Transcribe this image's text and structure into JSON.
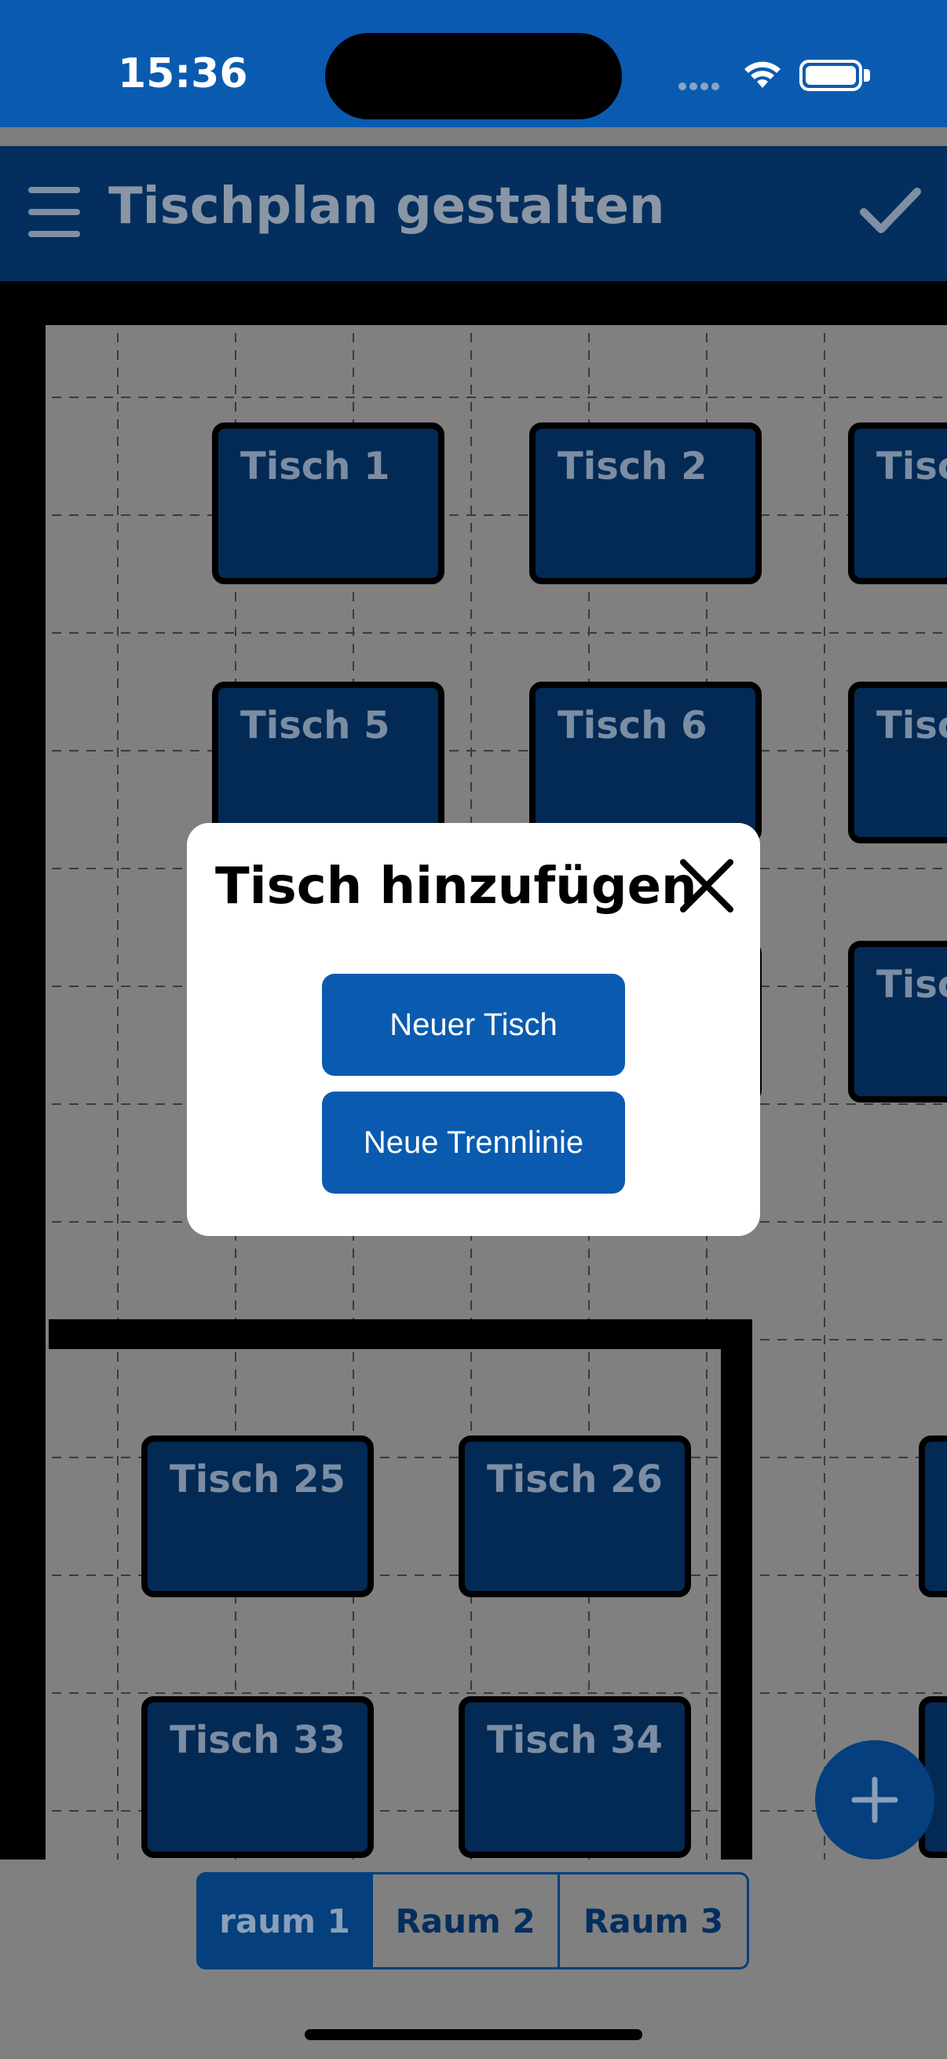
{
  "status": {
    "time": "15:36"
  },
  "appbar": {
    "title": "Tischplan gestalten",
    "menu_icon": "hamburger-menu-icon",
    "confirm_icon": "checkmark-icon"
  },
  "tables": [
    {
      "label": "Tisch 1"
    },
    {
      "label": "Tisch 2"
    },
    {
      "label": "Tisc"
    },
    {
      "label": "Tisch 5"
    },
    {
      "label": "Tisch 6"
    },
    {
      "label": "Tisc"
    },
    {
      "label": "Tisc"
    },
    {
      "label": "Tisch 25"
    },
    {
      "label": "Tisch 26"
    },
    {
      "label": "Tisch 33"
    },
    {
      "label": "Tisch 34"
    }
  ],
  "fab": {
    "icon": "plus-icon"
  },
  "rooms": {
    "tabs": [
      "raum 1",
      "Raum 2",
      "Raum 3"
    ],
    "active": "raum 1"
  },
  "dialog": {
    "title": "Tisch hinzufügen",
    "close_icon": "close-icon",
    "new_table_label": "Neuer Tisch",
    "new_divider_label": "Neue Trennlinie"
  },
  "colors": {
    "status_bar": "#0a5bb0",
    "app_bar": "#032e5d",
    "table_fill": "#032a55",
    "primary_button": "#0a5bb0",
    "overlay": "#808080"
  }
}
